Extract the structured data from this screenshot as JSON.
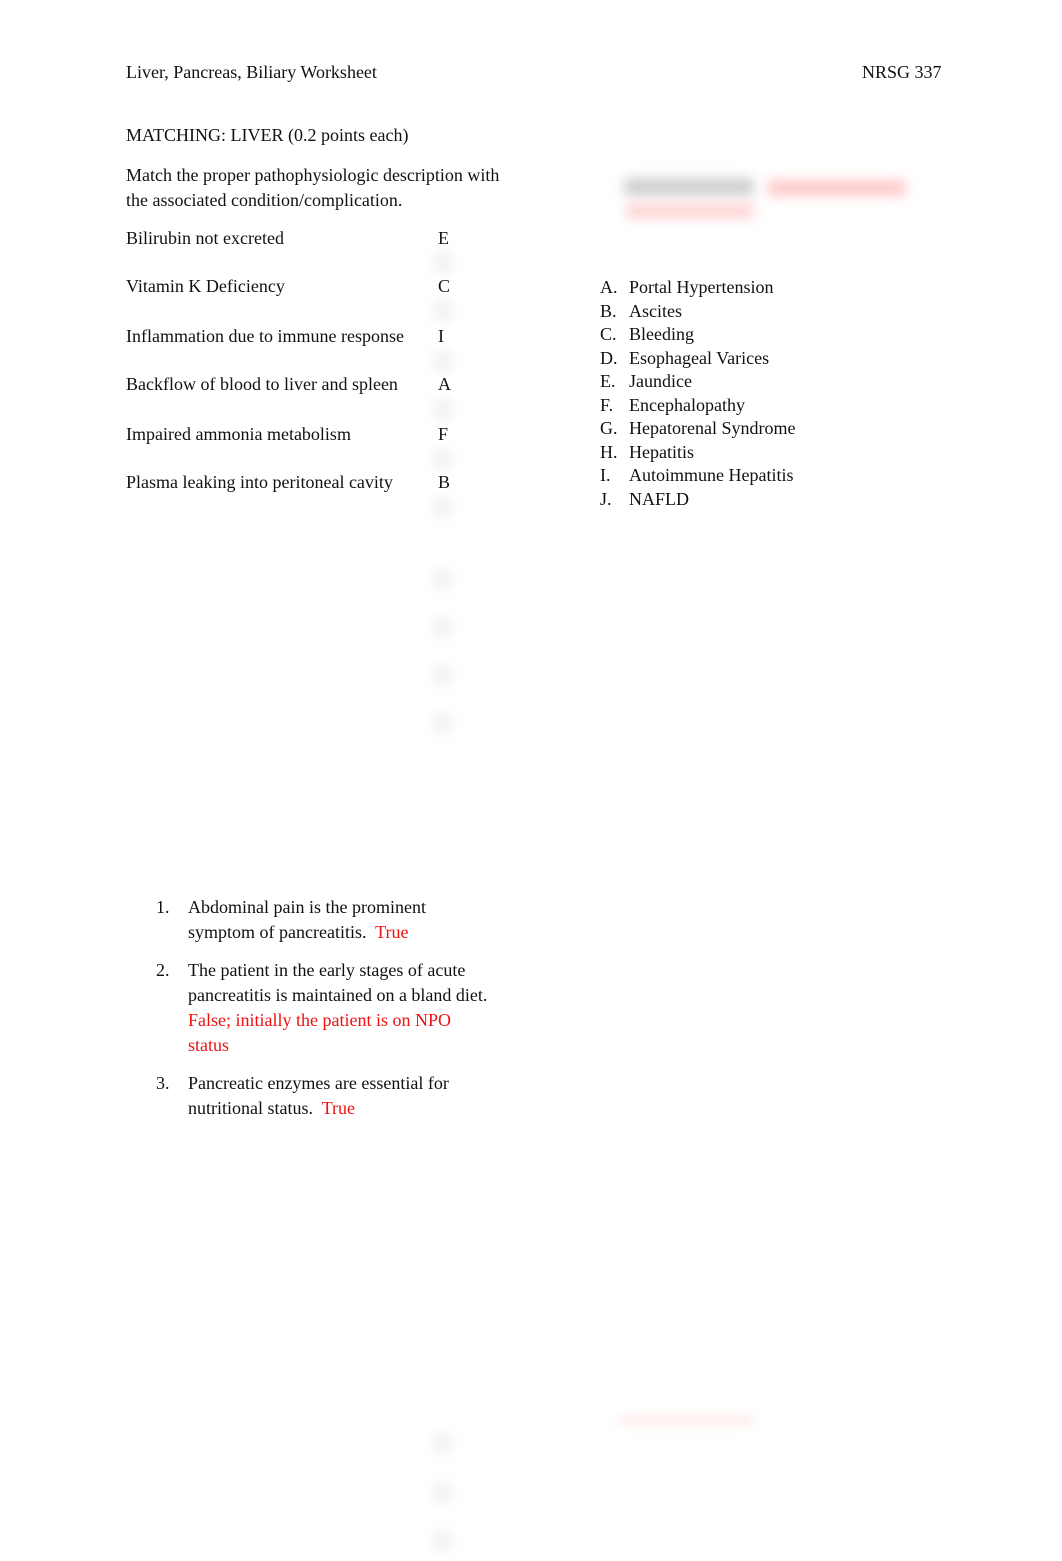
{
  "header": {
    "title": "Liver, Pancreas, Biliary Worksheet",
    "course": "NRSG 337"
  },
  "matching": {
    "section_title": "MATCHING: LIVER (0.2 points each)",
    "instructions": "Match the proper pathophysiologic description with the associated condition/complication.",
    "items": [
      {
        "description": "Bilirubin not excreted",
        "answer": "E"
      },
      {
        "description": "Vitamin K Deficiency",
        "answer": "C"
      },
      {
        "description": "Inflammation due to immune response",
        "answer": "I"
      },
      {
        "description": "Backflow of blood to liver and spleen",
        "answer": "A"
      },
      {
        "description": "Impaired ammonia metabolism",
        "answer": "F"
      },
      {
        "description": "Plasma leaking into peritoneal cavity",
        "answer": "B"
      }
    ],
    "options": [
      {
        "letter": "A.",
        "label": "Portal Hypertension"
      },
      {
        "letter": "B.",
        "label": "Ascites"
      },
      {
        "letter": "C.",
        "label": "Bleeding"
      },
      {
        "letter": "D.",
        "label": "Esophageal Varices"
      },
      {
        "letter": "E.",
        "label": "Jaundice"
      },
      {
        "letter": "F.",
        "label": "Encephalopathy"
      },
      {
        "letter": "G.",
        "label": "Hepatorenal Syndrome"
      },
      {
        "letter": "H.",
        "label": "Hepatitis"
      },
      {
        "letter": "I.",
        "label": "Autoimmune Hepatitis"
      },
      {
        "letter": "J.",
        "label": "NAFLD"
      }
    ]
  },
  "true_false": {
    "items": [
      {
        "number": "1.",
        "statement": "Abdominal pain is the prominent symptom of pancreatitis.",
        "answer": "True"
      },
      {
        "number": "2.",
        "statement": "The patient in the early stages of acute pancreatitis is maintained on a bland diet.",
        "answer": "False; initially the patient is on NPO status"
      },
      {
        "number": "3.",
        "statement": "Pancreatic enzymes are essential for nutritional status.",
        "answer": "True"
      }
    ]
  },
  "colors": {
    "answer_red": "#ee1111",
    "text": "#111111"
  }
}
